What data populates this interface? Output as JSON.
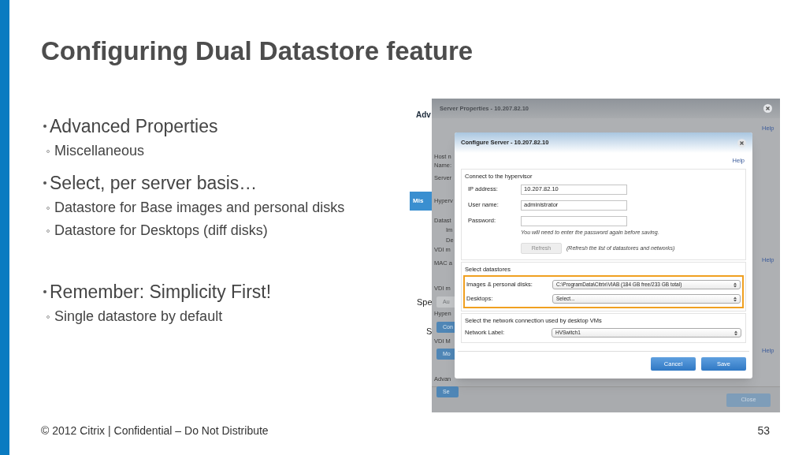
{
  "slide": {
    "title": "Configuring Dual Datastore feature",
    "bullets": [
      {
        "text": "Advanced Properties",
        "children": [
          {
            "text": "Miscellaneous"
          }
        ]
      },
      {
        "text": "Select, per server basis…",
        "children": [
          {
            "text": "Datastore for Base images and personal disks"
          },
          {
            "text": "Datastore for Desktops (diff disks)"
          }
        ]
      },
      {
        "text": "Remember: Simplicity First!",
        "children": [
          {
            "text": "Single datastore by default"
          }
        ]
      }
    ],
    "footer": "© 2012 Citrix | Confidential – Do Not Distribute",
    "page_number": "53"
  },
  "screenshot": {
    "underlying_page": [
      {
        "text": "Adv",
        "kind": "heading"
      },
      {
        "text": "Mis",
        "kind": "tab"
      },
      {
        "text": "Spe",
        "kind": "label"
      },
      {
        "text": "S",
        "kind": "label"
      }
    ],
    "server_properties": {
      "title": "Server Properties - 10.207.82.10",
      "fragments": [
        {
          "text": "Host n",
          "kind": "label"
        },
        {
          "text": "Name:",
          "kind": "label"
        },
        {
          "text": "Server",
          "kind": "label"
        },
        {
          "text": "Hyperv",
          "kind": "label"
        },
        {
          "text": "Datast",
          "kind": "label"
        },
        {
          "text": "Im",
          "kind": "label"
        },
        {
          "text": "De",
          "kind": "label"
        },
        {
          "text": "VDI m",
          "kind": "label"
        },
        {
          "text": "MAC a",
          "kind": "label"
        },
        {
          "text": "VDI m",
          "kind": "label"
        },
        {
          "text": "Au",
          "kind": "button"
        },
        {
          "text": "Hypen",
          "kind": "label"
        },
        {
          "text": "Con",
          "kind": "button"
        },
        {
          "text": "VDI M",
          "kind": "label"
        },
        {
          "text": "Mo",
          "kind": "button"
        },
        {
          "text": "Advan",
          "kind": "label"
        },
        {
          "text": "Se",
          "kind": "button"
        }
      ],
      "help_links": [
        "Help",
        "Help",
        "Help"
      ],
      "close_button": "Close"
    },
    "configure_server": {
      "title": "Configure Server - 10.207.82.10",
      "help": "Help",
      "connect": {
        "title": "Connect to the hypervisor",
        "fields": [
          {
            "label": "IP address:",
            "value": "10.207.82.10"
          },
          {
            "label": "User name:",
            "value": "administrator"
          },
          {
            "label": "Password:"
          }
        ],
        "hint": "You will need to enter the password again before saving.",
        "refresh_button": {
          "label": "Refresh",
          "disabled": true
        },
        "refresh_note": "(Refresh the list of datastores and networks)"
      },
      "datastores": {
        "title": "Select datastores",
        "highlighted": true,
        "selects": [
          {
            "label": "Images & personal disks:",
            "value": "C:\\ProgramData\\Citrix\\VIAB (184 GB free/233 GB total)"
          },
          {
            "label": "Desktops:",
            "value": "Select..."
          }
        ]
      },
      "network": {
        "title": "Select the network connection used by desktop VMs",
        "selects": [
          {
            "label": "Network Label:",
            "value": "HVSwitch1"
          }
        ]
      },
      "buttons": [
        "Cancel",
        "Save"
      ]
    }
  }
}
